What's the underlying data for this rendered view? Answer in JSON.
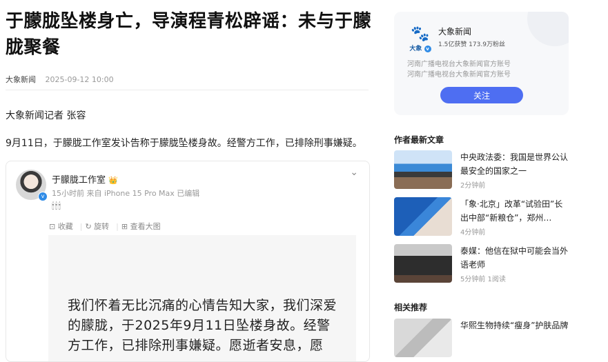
{
  "article": {
    "title": "于朦胧坠楼身亡，导演程青松辟谣：未与于朦胧聚餐",
    "source": "大象新闻",
    "date": "2025-09-12 10:00",
    "reporter_line": "大象新闻记者 张容",
    "lead": "9月11日，于朦胧工作室发讣告称于朦胧坠楼身故。经警方工作，已排除刑事嫌疑。"
  },
  "weibo": {
    "name": "于朦胧工作室",
    "crown": "👑",
    "sub": "15小时前 来自 iPhone 15 Pro Max 已编辑",
    "candles": "🕯🕯🕯",
    "actions": [
      "收藏",
      "旋转",
      "查看大图"
    ],
    "image_text": "我们怀着无比沉痛的心情告知大家，我们深爱的朦胧，于2025年9月11日坠楼身故。经警方工作，已排除刑事嫌疑。愿逝者安息，愿"
  },
  "account": {
    "logo_label": "大象",
    "name": "大象新闻",
    "stats": "1.5亿获赞 173.9万粉丝",
    "desc1": "河南广播电视台大象新闻官方账号",
    "desc2": "河南广播电视台大象新闻官方账号",
    "follow_label": "关注"
  },
  "sidebar": {
    "latest_title": "作者最新文章",
    "latest": [
      {
        "headline": "中央政法委：我国是世界公认最安全的国家之一",
        "time": "2分钟前"
      },
      {
        "headline": "「象·北京」改革“试验田”长出中部“新粮仓”，郑州…",
        "time": "4分钟前"
      },
      {
        "headline": "泰媒：他信在狱中可能会当外语老师",
        "time": "5分钟前  1阅读"
      }
    ],
    "related_title": "相关推荐",
    "related": [
      {
        "headline": "华熙生物持续“瘦身”护肤品牌",
        "time": ""
      }
    ]
  }
}
